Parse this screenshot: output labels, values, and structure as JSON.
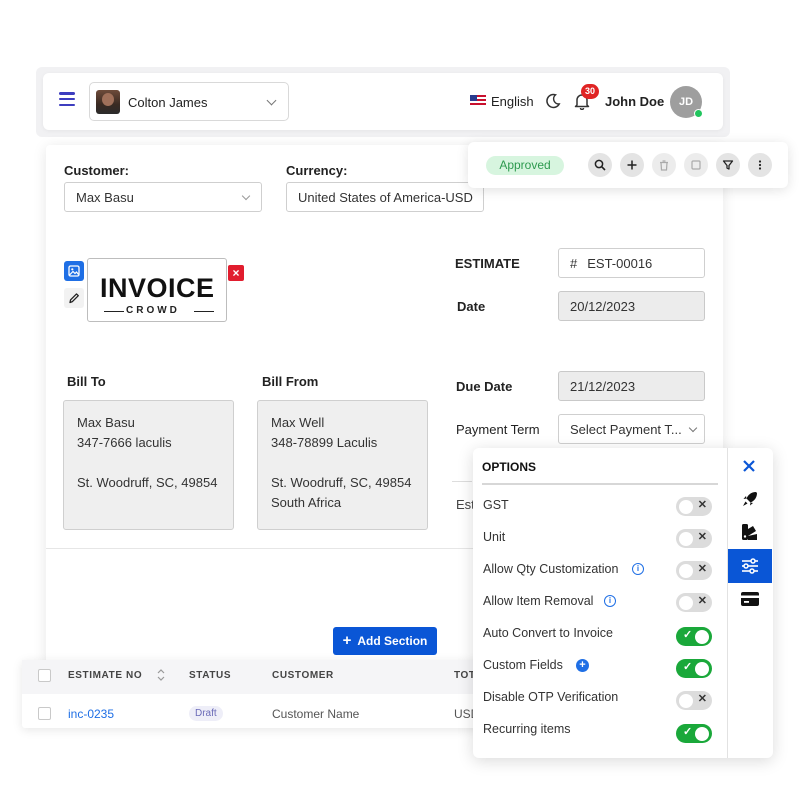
{
  "topbar": {
    "selected_user": "Colton James",
    "language": "English",
    "notification_count": "30",
    "user_name": "John Doe",
    "user_initials": "JD"
  },
  "form": {
    "customer_label": "Customer:",
    "customer_value": "Max Basu",
    "currency_label": "Currency:",
    "currency_value": "United States of America-USD",
    "estimate_label": "ESTIMATE",
    "estimate_prefix": "#",
    "estimate_value": "EST-00016",
    "date_label": "Date",
    "date_value": "20/12/2023",
    "due_date_label": "Due Date",
    "due_date_value": "21/12/2023",
    "payment_term_label": "Payment Term",
    "payment_term_placeholder": "Select Payment T...",
    "partial_label": "Est",
    "logo_text": "INVOICE",
    "logo_sub": "CROWD"
  },
  "bill_to": {
    "label": "Bill To",
    "lines": [
      "Max Basu",
      "347-7666 laculis",
      "",
      "St. Woodruff, SC, 49854"
    ]
  },
  "bill_from": {
    "label": "Bill From",
    "lines": [
      "Max Well",
      "348-78899 Laculis",
      "",
      "St. Woodruff, SC, 49854",
      "South Africa"
    ]
  },
  "add_section_label": "Add Section",
  "toolbar": {
    "status": "Approved"
  },
  "table": {
    "headers": [
      "ESTIMATE NO",
      "STATUS",
      "CUSTOMER",
      "TOT"
    ],
    "rows": [
      {
        "estimate_no": "inc-0235",
        "status": "Draft",
        "customer": "Customer Name",
        "total": "USD"
      }
    ]
  },
  "options": {
    "title": "OPTIONS",
    "items": [
      {
        "label": "GST",
        "on": false
      },
      {
        "label": "Unit",
        "on": false
      },
      {
        "label": "Allow Qty Customization",
        "on": false
      },
      {
        "label": "Allow Item Removal",
        "on": false
      },
      {
        "label": "Auto Convert to Invoice",
        "on": true
      },
      {
        "label": "Custom Fields",
        "on": true
      },
      {
        "label": "Disable OTP Verification",
        "on": false
      },
      {
        "label": "Recurring items",
        "on": true
      }
    ]
  },
  "colors": {
    "primary": "#0a56d6",
    "approved_bg": "#d7f5df",
    "approved_text": "#2e9a4f",
    "toggle_on": "#1aa83a",
    "danger": "#e11d2e"
  },
  "icons": [
    "menu-icon",
    "chevron-down-icon",
    "moon-icon",
    "bell-icon",
    "search-icon",
    "plus-icon",
    "trash-icon",
    "square-icon",
    "filter-icon",
    "more-vertical-icon",
    "image-icon",
    "pencil-icon",
    "close-icon",
    "rocket-icon",
    "palette-icon",
    "sliders-icon",
    "credit-card-icon",
    "info-icon",
    "sort-icon"
  ]
}
